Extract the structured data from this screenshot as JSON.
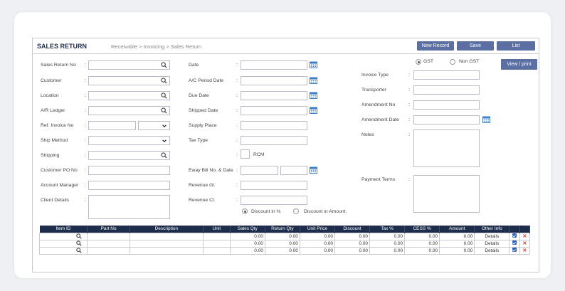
{
  "header": {
    "title": "SALES RETURN",
    "breadcrumb": "Receivable > Invoicing > Sales Return",
    "new_record": "New Record",
    "save": "Save",
    "list": "List"
  },
  "view_print": "View / print",
  "gst": {
    "gst_label": "GST",
    "non_gst_label": "Non GST",
    "selected": "GST"
  },
  "col1": [
    "Sales Return No",
    "Customer",
    "Location",
    "A/R Ledger",
    "Ref. Invoice No",
    "Ship Method",
    "Shipping",
    "Customer PO No",
    "Account Manager",
    "Client Details"
  ],
  "col2": [
    "Date",
    "A/C Period Date",
    "Due Date",
    "Shipped Date",
    "Supply Place",
    "Tax Type",
    "Eway Bill No. & Date",
    "Revenue Gl.",
    "Revenue Cl."
  ],
  "rcm_label": "RCM",
  "discount": {
    "pct": "Discount in %",
    "amt": "Discount in Amount.",
    "selected": "pct"
  },
  "col3": [
    "Invoice Type",
    "Transporter",
    "Amendment No",
    "Amendment Date",
    "Notes",
    "Payment Terms"
  ],
  "table": {
    "columns": [
      "Item ID",
      "Part No",
      "Description",
      "Unit",
      "Sales Qty",
      "Return Qty",
      "Unit Price",
      "Discount",
      "Tax %",
      "CESS %",
      "Amount",
      "Other Info"
    ],
    "rows": [
      {
        "sales_qty": "0.00",
        "return_qty": "0.00",
        "unit_price": "0.00",
        "discount": "0.00",
        "tax": "0.00",
        "cess": "0.00",
        "amount": "0.00",
        "other": "Details"
      },
      {
        "sales_qty": "0.00",
        "return_qty": "0.00",
        "unit_price": "0.00",
        "discount": "0.00",
        "tax": "0.00",
        "cess": "0.00",
        "amount": "0.00",
        "other": "Details"
      },
      {
        "sales_qty": "0.00",
        "return_qty": "0.00",
        "unit_price": "0.00",
        "discount": "0.00",
        "tax": "0.00",
        "cess": "0.00",
        "amount": "0.00",
        "other": "Details"
      }
    ]
  },
  "colors": {
    "navy": "#1f2d4d",
    "button": "#5b6fa3",
    "calendar": "#3b7fc4",
    "delete": "#d23a3a"
  }
}
